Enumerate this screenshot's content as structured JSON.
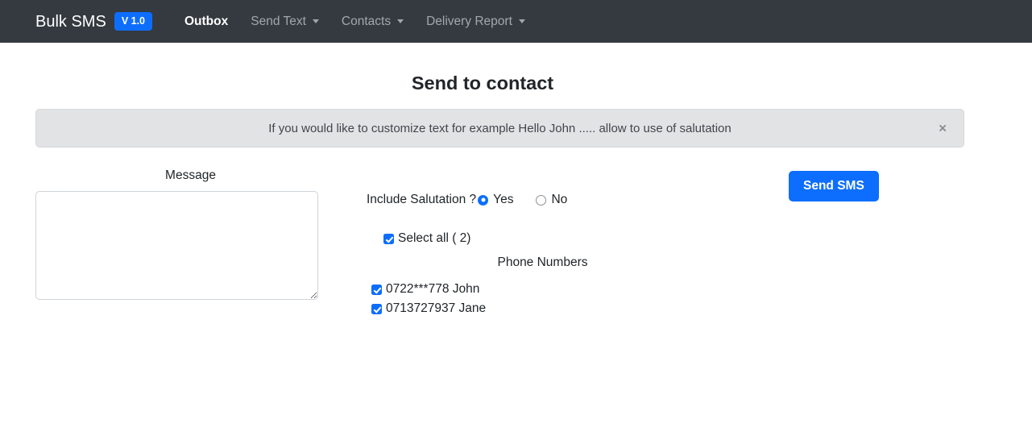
{
  "navbar": {
    "brand": "Bulk SMS",
    "version_badge": "V 1.0",
    "items": [
      {
        "label": "Outbox",
        "active": true,
        "dropdown": false
      },
      {
        "label": "Send Text",
        "active": false,
        "dropdown": true
      },
      {
        "label": "Contacts",
        "active": false,
        "dropdown": true
      },
      {
        "label": "Delivery Report",
        "active": false,
        "dropdown": true
      }
    ],
    "background": "#343a40",
    "badge_color": "#0d6efd"
  },
  "page": {
    "title": "Send to contact"
  },
  "alert": {
    "text": "If you would like to customize text for example Hello John ..... allow to use of salutation",
    "close_label": "×",
    "background": "#e2e3e5"
  },
  "form": {
    "message_label": "Message",
    "message_value": "",
    "message_placeholder": "",
    "salutation_question": "Include Salutation ?",
    "salutation_options": [
      {
        "label": "Yes",
        "checked": true
      },
      {
        "label": "No",
        "checked": false
      }
    ],
    "select_all_label": "Select all ( 2)",
    "select_all_checked": true,
    "phone_numbers_header": "Phone Numbers",
    "contacts": [
      {
        "number": "0722***778",
        "name": "John",
        "label": "0722***778 John",
        "checked": true
      },
      {
        "number": "0713727937",
        "name": "Jane",
        "label": "0713727937 Jane",
        "checked": true
      }
    ],
    "send_button_label": "Send SMS",
    "accent_color": "#0d6efd"
  }
}
